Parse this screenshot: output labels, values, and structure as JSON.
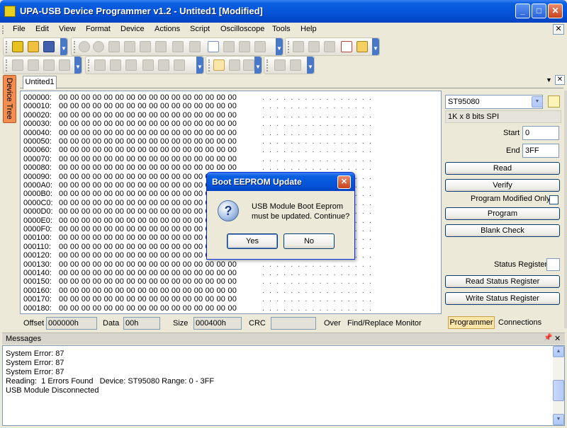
{
  "window": {
    "title": "UPA-USB Device Programmer v1.2 - Untited1 [Modified]"
  },
  "caption_buttons": {
    "minimize": "_",
    "maximize": "□",
    "close": "✕"
  },
  "menu": [
    "File",
    "Edit",
    "View",
    "Format",
    "Device",
    "Actions",
    "Script",
    "Oscilloscope",
    "Tools",
    "Help"
  ],
  "document": {
    "tab_label": "Untited1"
  },
  "side_tab": {
    "label": "Device Tree"
  },
  "hex": {
    "rows": [
      {
        "addr": "000000:",
        "bytes": "00 00 00 00 00 00 00 00 00 00 00 00 00 00 00 00",
        "ascii": "................"
      },
      {
        "addr": "000010:",
        "bytes": "00 00 00 00 00 00 00 00 00 00 00 00 00 00 00 00",
        "ascii": "................"
      },
      {
        "addr": "000020:",
        "bytes": "00 00 00 00 00 00 00 00 00 00 00 00 00 00 00 00",
        "ascii": "................"
      },
      {
        "addr": "000030:",
        "bytes": "00 00 00 00 00 00 00 00 00 00 00 00 00 00 00 00",
        "ascii": "................"
      },
      {
        "addr": "000040:",
        "bytes": "00 00 00 00 00 00 00 00 00 00 00 00 00 00 00 00",
        "ascii": "................"
      },
      {
        "addr": "000050:",
        "bytes": "00 00 00 00 00 00 00 00 00 00 00 00 00 00 00 00",
        "ascii": "................"
      },
      {
        "addr": "000060:",
        "bytes": "00 00 00 00 00 00 00 00 00 00 00 00 00 00 00 00",
        "ascii": "................"
      },
      {
        "addr": "000070:",
        "bytes": "00 00 00 00 00 00 00 00 00 00 00 00 00 00 00 00",
        "ascii": "................"
      },
      {
        "addr": "000080:",
        "bytes": "00 00 00 00 00 00 00 00 00 00 00 00 00 00 00 00",
        "ascii": "................"
      },
      {
        "addr": "000090:",
        "bytes": "00 00 00 00 00 00 00 00 00 00 00 00 00 00 00 00",
        "ascii": "................"
      },
      {
        "addr": "0000A0:",
        "bytes": "00 00 00 00 00 00 00 00 00 00 00 00 00 00 00 00",
        "ascii": "................"
      },
      {
        "addr": "0000B0:",
        "bytes": "00 00 00 00 00 00 00 00 00 00 00 00 00 00 00 00",
        "ascii": "................"
      },
      {
        "addr": "0000C0:",
        "bytes": "00 00 00 00 00 00 00 00 00 00 00 00 00 00 00 00",
        "ascii": "................"
      },
      {
        "addr": "0000D0:",
        "bytes": "00 00 00 00 00 00 00 00 00 00 00 00 00 00 00 00",
        "ascii": "................"
      },
      {
        "addr": "0000E0:",
        "bytes": "00 00 00 00 00 00 00 00 00 00 00 00 00 00 00 00",
        "ascii": "................"
      },
      {
        "addr": "0000F0:",
        "bytes": "00 00 00 00 00 00 00 00 00 00 00 00 00 00 00 00",
        "ascii": "................"
      },
      {
        "addr": "000100:",
        "bytes": "00 00 00 00 00 00 00 00 00 00 00 00 00 00 00 00",
        "ascii": "................"
      },
      {
        "addr": "000110:",
        "bytes": "00 00 00 00 00 00 00 00 00 00 00 00 00 00 00 00",
        "ascii": "................"
      },
      {
        "addr": "000120:",
        "bytes": "00 00 00 00 00 00 00 00 00 00 00 00 00 00 00 00",
        "ascii": "................"
      },
      {
        "addr": "000130:",
        "bytes": "00 00 00 00 00 00 00 00 00 00 00 00 00 00 00 00",
        "ascii": "................"
      },
      {
        "addr": "000140:",
        "bytes": "00 00 00 00 00 00 00 00 00 00 00 00 00 00 00 00",
        "ascii": "................"
      },
      {
        "addr": "000150:",
        "bytes": "00 00 00 00 00 00 00 00 00 00 00 00 00 00 00 00",
        "ascii": "................"
      },
      {
        "addr": "000160:",
        "bytes": "00 00 00 00 00 00 00 00 00 00 00 00 00 00 00 00",
        "ascii": "................"
      },
      {
        "addr": "000170:",
        "bytes": "00 00 00 00 00 00 00 00 00 00 00 00 00 00 00 00",
        "ascii": "................"
      },
      {
        "addr": "000180:",
        "bytes": "00 00 00 00 00 00 00 00 00 00 00 00 00 00 00 00",
        "ascii": "................"
      }
    ]
  },
  "infobar": {
    "offset_label": "Offset",
    "offset_value": "000000h",
    "data_label": "Data",
    "data_value": "00h",
    "size_label": "Size",
    "size_value": "000400h",
    "crc_label": "CRC",
    "crc_value": "",
    "over_label": "Over",
    "find_replace_label": "Find/Replace",
    "monitor_label": "Monitor"
  },
  "programmer": {
    "device": "ST95080",
    "device_type": "1K x 8 bits SPI",
    "start_label": "Start",
    "start_value": "0",
    "end_label": "End",
    "end_value": "3FF",
    "read_label": "Read",
    "verify_label": "Verify",
    "program_modified_only_label": "Program Modified Only",
    "program_label": "Program",
    "blank_check_label": "Blank Check",
    "status_register_label": "Status Register",
    "status_register_value": "",
    "read_status_label": "Read Status Register",
    "write_status_label": "Write Status Register"
  },
  "panel_tabs": {
    "programmer": "Programmer",
    "connections": "Connections"
  },
  "messages": {
    "title": "Messages",
    "lines": [
      "System Error: 87",
      "System Error: 87",
      "System Error: 87",
      "Reading:  1 Errors Found   Device: ST95080 Range: 0 - 3FF",
      "USB Module Disconnected"
    ]
  },
  "dialog": {
    "title": "Boot EEPROM Update",
    "message_line1": "USB Module Boot Eeprom",
    "message_line2": "must be updated. Continue?",
    "yes_label": "Yes",
    "no_label": "No"
  }
}
